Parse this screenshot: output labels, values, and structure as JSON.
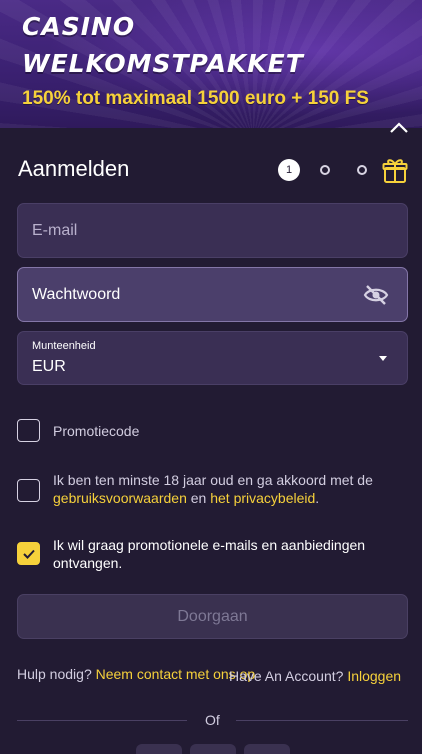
{
  "banner": {
    "title_line1": "CASINO",
    "title_line2": "WELKOMSTPAKKET",
    "subtitle": "150% tot maximaal 1500 euro + 150 FS"
  },
  "form": {
    "title": "Aanmelden",
    "steps": {
      "active": "1",
      "total": 3
    },
    "email": {
      "placeholder": "E-mail"
    },
    "password": {
      "placeholder": "Wachtwoord"
    },
    "currency": {
      "label": "Munteenheid",
      "value": "EUR"
    },
    "promo": {
      "label": "Promotiecode",
      "checked": false
    },
    "terms": {
      "text_before": "Ik ben ten minste 18 jaar oud en ga akkoord met de",
      "link1": "gebruiksvoorwaarden",
      "text_middle": "en",
      "link2": "het privacybeleid",
      "text_after": ".",
      "checked": false
    },
    "marketing": {
      "text": "Ik wil graag promotionele e-mails en aanbiedingen ontvangen.",
      "checked": true
    },
    "submit_label": "Doorgaan"
  },
  "footer": {
    "help_text": "Hulp nodig?",
    "help_link": "Neem contact met ons op",
    "have_account_text": "Have An Account?",
    "login_link": "Inloggen",
    "or_text": "Of"
  },
  "colors": {
    "background": "#221b33",
    "banner": "#3a2070",
    "accent_yellow": "#f6d13b",
    "field_bg": "#3a2f54"
  }
}
